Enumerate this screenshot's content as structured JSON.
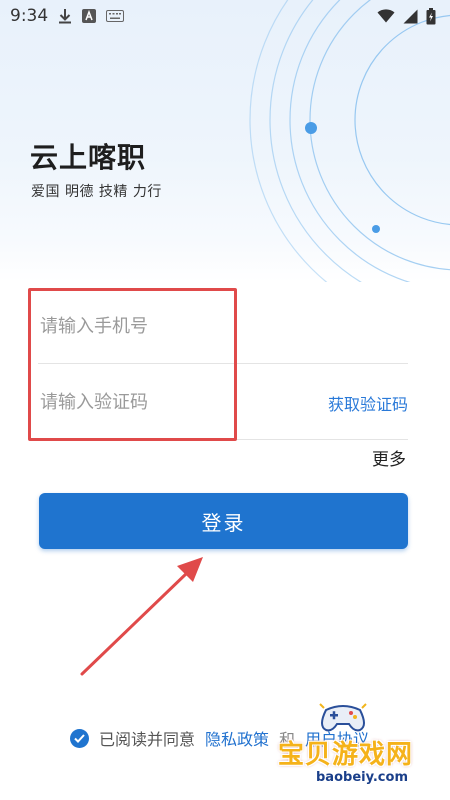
{
  "status_bar": {
    "time": "9:34",
    "left_icons": [
      "download-icon",
      "a-notification-icon",
      "keyboard-icon"
    ],
    "right_icons": [
      "wifi-icon",
      "signal-icon",
      "battery-icon"
    ]
  },
  "app": {
    "title": "云上喀职",
    "slogan": "爱国 明德 技精 力行"
  },
  "form": {
    "phone_placeholder": "请输入手机号",
    "phone_value": "",
    "code_placeholder": "请输入验证码",
    "code_value": "",
    "get_code_label": "获取验证码"
  },
  "more_label": "更多",
  "login_label": "登录",
  "agreement": {
    "checked": true,
    "prefix": "已阅读并同意",
    "privacy_policy": "隐私政策",
    "and": "和",
    "user_agreement": "用户协议"
  },
  "watermark": {
    "text": "宝贝游戏网",
    "url": "baobeiy.com"
  },
  "colors": {
    "primary": "#1f74cf",
    "link": "#2979d8",
    "highlight": "#e04a4a",
    "watermark": "#f5b21a"
  }
}
